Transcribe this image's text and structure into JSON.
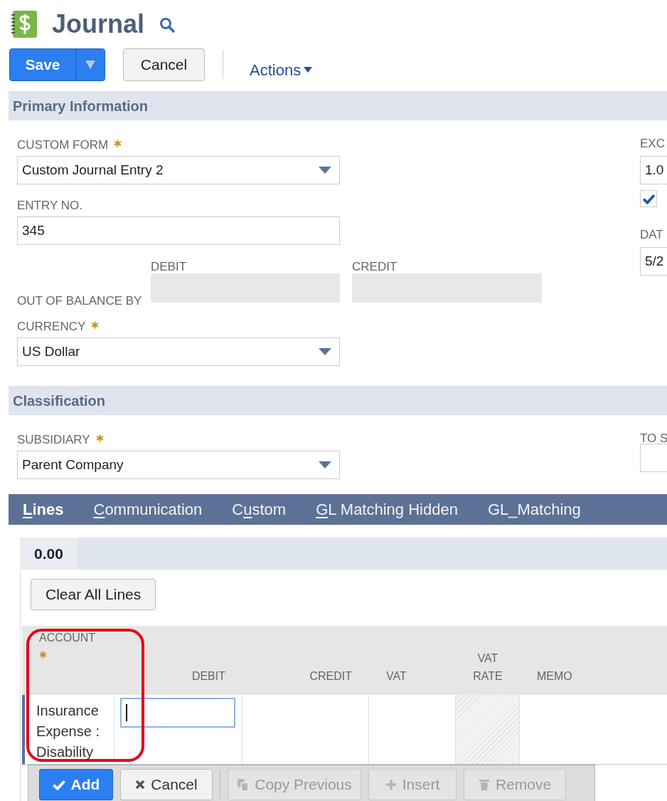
{
  "header": {
    "title": "Journal"
  },
  "toolbar": {
    "save": "Save",
    "cancel": "Cancel",
    "actions": "Actions"
  },
  "primary_information": {
    "heading": "Primary Information",
    "custom_form": {
      "label": "CUSTOM FORM",
      "required": true,
      "value": "Custom Journal Entry 2"
    },
    "entry_no": {
      "label": "ENTRY NO.",
      "value": "345"
    },
    "out_of_balance": {
      "label": "OUT OF BALANCE BY",
      "debit_label": "DEBIT",
      "credit_label": "CREDIT"
    },
    "currency": {
      "label": "CURRENCY",
      "required": true,
      "value": "US Dollar"
    },
    "exchange_rate": {
      "label": "EXC",
      "value": "1.0"
    },
    "checkbox": {
      "checked": true
    },
    "date": {
      "label": "DAT",
      "value": "5/2"
    }
  },
  "classification": {
    "heading": "Classification",
    "subsidiary": {
      "label": "SUBSIDIARY",
      "required": true,
      "value": "Parent Company"
    },
    "to_field": {
      "label": "TO S"
    }
  },
  "tabs": [
    {
      "parts": [
        {
          "text": "L",
          "underlined": true
        },
        {
          "text": "ines",
          "underlined": false
        }
      ],
      "selected": true
    },
    {
      "parts": [
        {
          "text": "C",
          "underlined": true
        },
        {
          "text": "ommunication",
          "underlined": false
        }
      ],
      "selected": false
    },
    {
      "parts": [
        {
          "text": "C",
          "underlined": false
        },
        {
          "text": "u",
          "underlined": true
        },
        {
          "text": "stom",
          "underlined": false
        }
      ],
      "selected": false
    },
    {
      "parts": [
        {
          "text": "G",
          "underlined": true
        },
        {
          "text": "L Matching Hidden",
          "underlined": false
        }
      ],
      "selected": false
    },
    {
      "parts": [
        {
          "text": "GL_Matching",
          "underlined": false
        }
      ],
      "selected": false
    }
  ],
  "subtab": {
    "label": "0.00",
    "selected": true
  },
  "clear_button": "Clear All Lines",
  "lines_table": {
    "columns": [
      {
        "label": "ACCOUNT",
        "required": true
      },
      {
        "label": "DEBIT",
        "required": false
      },
      {
        "label": "CREDIT",
        "required": false
      },
      {
        "label": "VAT",
        "required": false
      },
      {
        "label": "VAT RATE",
        "required": false
      },
      {
        "label": "MEMO",
        "required": false
      }
    ],
    "row": {
      "account": "Insurance Expense : Disability"
    }
  },
  "line_buttons": [
    {
      "label": "Add",
      "kind": "primary",
      "disabled": false
    },
    {
      "label": "Cancel",
      "kind": "default",
      "disabled": false
    },
    {
      "label": "Copy Previous",
      "kind": "default",
      "disabled": true
    },
    {
      "label": "Insert",
      "kind": "default",
      "disabled": true
    },
    {
      "label": "Remove",
      "kind": "default",
      "disabled": true
    }
  ]
}
